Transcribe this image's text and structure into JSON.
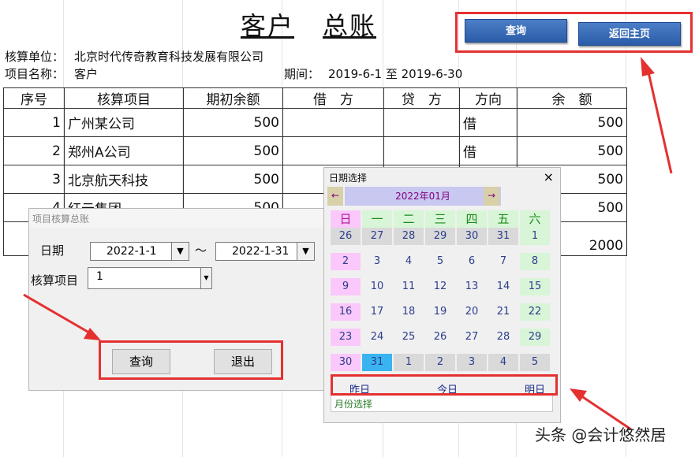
{
  "page_title_left": "客户",
  "page_title_right": "总账",
  "buttons": {
    "query": "查询",
    "home": "返回主页"
  },
  "info": {
    "unit_label": "核算单位：",
    "unit_value": "北京时代传奇教育科技发展有限公司",
    "project_label": "项目名称：",
    "project_value": "客户",
    "period_label": "期间：",
    "period_value": "2019-6-1 至 2019-6-30"
  },
  "table": {
    "headers": [
      "序号",
      "核算项目",
      "期初余额",
      "借　方",
      "贷　方",
      "方向",
      "余　额"
    ],
    "rows": [
      [
        "1",
        "广州某公司",
        "500",
        "",
        "",
        "借",
        "500"
      ],
      [
        "2",
        "郑州A公司",
        "500",
        "",
        "",
        "借",
        "500"
      ],
      [
        "3",
        "北京航天科技",
        "500",
        "",
        "",
        "",
        "500"
      ],
      [
        "4",
        "红云集团",
        "500",
        "",
        "",
        "",
        "500"
      ]
    ],
    "total": "2000"
  },
  "dialog": {
    "title": "项目核算总账",
    "date_label": "日期",
    "date_from": "2022-1-1",
    "tilde": "～",
    "date_to": "2022-1-31",
    "project_label": "核算项目",
    "project_value": "1",
    "query_btn": "查询",
    "exit_btn": "退出"
  },
  "calendar": {
    "title": "日期选择",
    "close": "×",
    "prev": "←",
    "next": "→",
    "month": "2022年01月",
    "weekdays": [
      "日",
      "一",
      "二",
      "三",
      "四",
      "五",
      "六"
    ],
    "weeks": [
      [
        "26",
        "27",
        "28",
        "29",
        "30",
        "31",
        "1"
      ],
      [
        "2",
        "3",
        "4",
        "5",
        "6",
        "7",
        "8"
      ],
      [
        "9",
        "10",
        "11",
        "12",
        "13",
        "14",
        "15"
      ],
      [
        "16",
        "17",
        "18",
        "19",
        "20",
        "21",
        "22"
      ],
      [
        "23",
        "24",
        "25",
        "26",
        "27",
        "28",
        "29"
      ],
      [
        "30",
        "31",
        "1",
        "2",
        "3",
        "4",
        "5"
      ]
    ],
    "selected_day": "31",
    "yesterday": "昨日",
    "today": "今日",
    "tomorrow": "明日",
    "month_select": "月份选择"
  },
  "watermark": "头条 @会计悠然居",
  "colors": {
    "accent_red": "#e53030",
    "button_blue": "#2a5ca8",
    "selected": "#3ab4f0"
  }
}
